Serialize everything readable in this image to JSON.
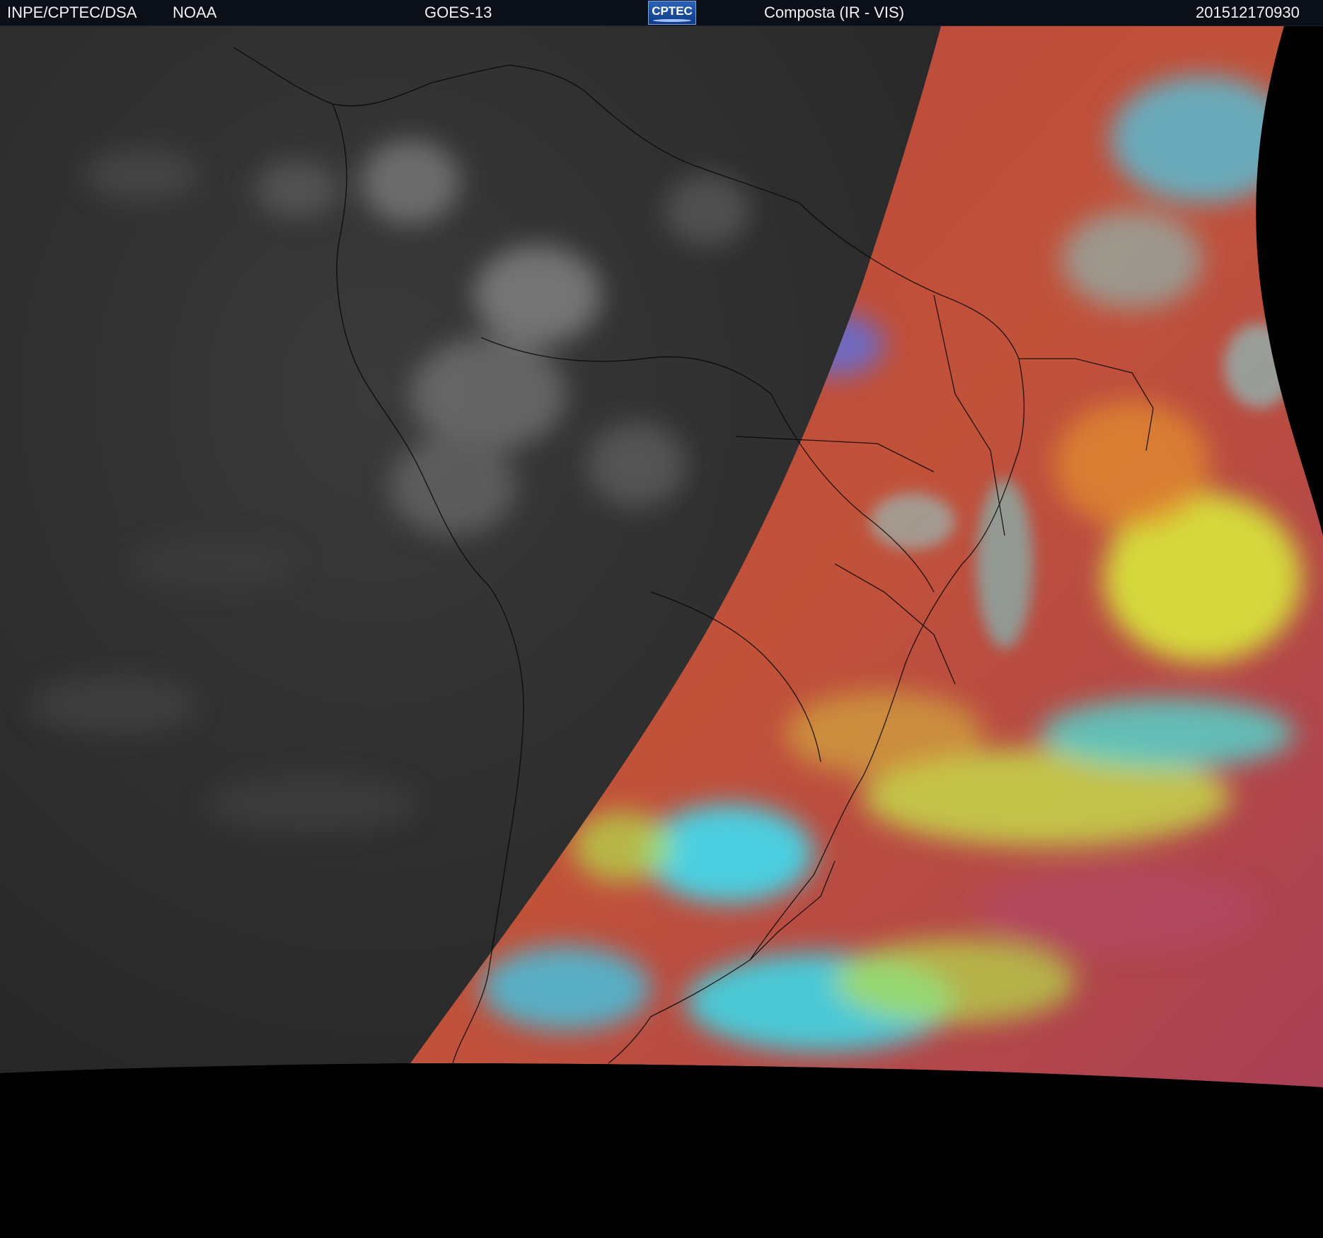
{
  "header": {
    "source": "INPE/CPTEC/DSA",
    "agency": "NOAA",
    "satellite": "GOES-13",
    "logo_text": "CPTEC",
    "product": "Composta (IR - VIS)",
    "timestamp": "201512170930"
  },
  "colors": {
    "header_bg": "#0b0f17",
    "night_side": "#2f2f2f",
    "day_side_base": "#b8443c",
    "cloud_cyan": "#3fd6e6",
    "cloud_yellow": "#c9e63a",
    "background": "#000000",
    "borders": "#000000"
  }
}
